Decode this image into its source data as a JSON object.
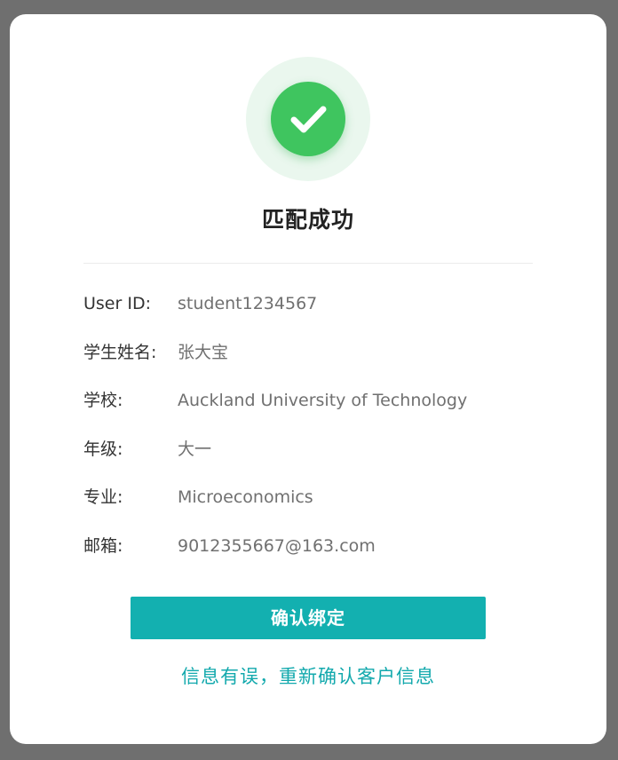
{
  "colors": {
    "accent": "#13b0b0",
    "success": "#3fc55f",
    "link": "#13a9ad"
  },
  "status_icon": "check-circle-icon",
  "title": "匹配成功",
  "fields": [
    {
      "label": "User ID:",
      "value": "student1234567"
    },
    {
      "label": "学生姓名:",
      "value": "张大宝"
    },
    {
      "label": "学校:",
      "value": "Auckland University of Technology"
    },
    {
      "label": "年级:",
      "value": "大一"
    },
    {
      "label": "专业:",
      "value": "Microeconomics"
    },
    {
      "label": "邮箱:",
      "value": "9012355667@163.com"
    }
  ],
  "actions": {
    "confirm_label": "确认绑定",
    "reconfirm_label": "信息有误，重新确认客户信息"
  }
}
